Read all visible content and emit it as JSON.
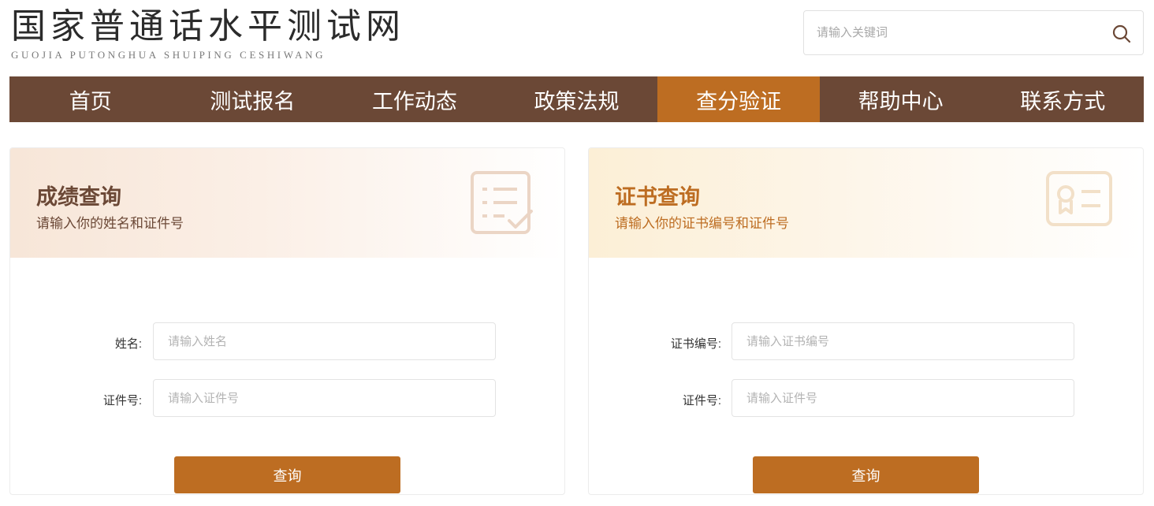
{
  "header": {
    "title": "国家普通话水平测试网",
    "subtitle": "GUOJIA PUTONGHUA SHUIPING CESHIWANG",
    "search": {
      "placeholder": "请输入关键词",
      "value": "",
      "icon": "search-icon"
    }
  },
  "nav": {
    "items": [
      {
        "label": "首页"
      },
      {
        "label": "测试报名"
      },
      {
        "label": "工作动态"
      },
      {
        "label": "政策法规"
      },
      {
        "label": "查分验证",
        "active": true
      },
      {
        "label": "帮助中心"
      },
      {
        "label": "联系方式"
      }
    ]
  },
  "score_query": {
    "title": "成绩查询",
    "description": "请输入你的姓名和证件号",
    "icon": "checklist-icon",
    "fields": [
      {
        "label": "姓名:",
        "placeholder": "请输入姓名",
        "value": ""
      },
      {
        "label": "证件号:",
        "placeholder": "请输入证件号",
        "value": ""
      }
    ],
    "submit_label": "查询"
  },
  "certificate_query": {
    "title": "证书查询",
    "description": "请输入你的证书编号和证件号",
    "icon": "id-card-icon",
    "fields": [
      {
        "label": "证书编号:",
        "placeholder": "请输入证书编号",
        "value": ""
      },
      {
        "label": "证件号:",
        "placeholder": "请输入证件号",
        "value": ""
      }
    ],
    "submit_label": "查询"
  },
  "colors": {
    "nav_bg": "#6b4836",
    "accent": "#bd6d22",
    "score_title": "#6b4836",
    "certificate_title": "#bd6d22"
  }
}
